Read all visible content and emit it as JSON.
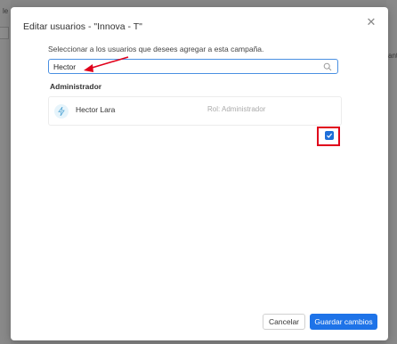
{
  "background": {
    "top_left_fragment": "le",
    "right_fragment": "ant"
  },
  "modal": {
    "title": "Editar usuarios - \"Innova - T\"",
    "close_symbol": "✕",
    "instruction": "Seleccionar a los usuarios que desees agregar a esta campaña.",
    "search": {
      "value": "Hector",
      "icon": "search-icon"
    },
    "groups": [
      {
        "title": "Administrador",
        "users": [
          {
            "name": "Hector Lara",
            "role": "Rol: Administrador",
            "selected": true,
            "icon": "lightning-icon"
          }
        ]
      }
    ],
    "footer": {
      "cancel_label": "Cancelar",
      "save_label": "Guardar cambios"
    }
  },
  "colors": {
    "primary": "#1e73e8",
    "annotation_red": "#e0001b",
    "overlay": "rgba(0,0,0,0.45)"
  }
}
